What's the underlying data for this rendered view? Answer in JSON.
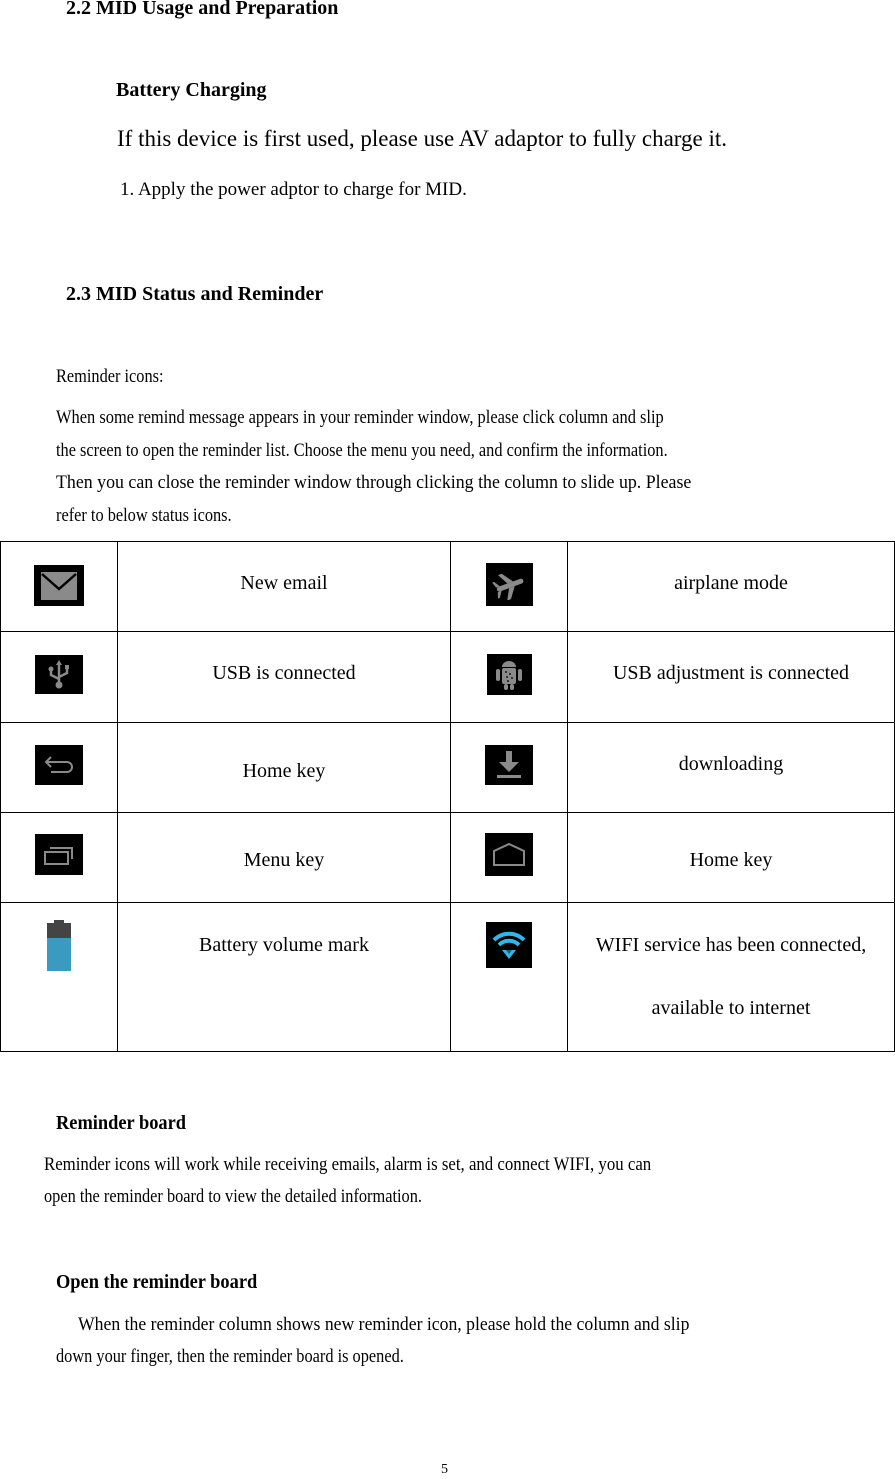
{
  "section_22": {
    "title": "2.2 MID Usage and Preparation",
    "battery_heading": "Battery Charging",
    "battery_note": "If this device is first used, please use AV adaptor to fully charge it.",
    "step_1": "1. Apply the power adptor to charge for MID."
  },
  "section_23": {
    "title": "2.3 MID Status and Reminder",
    "reminder_icons_label": "Reminder icons:",
    "paragraph_lines": [
      "When some remind message appears in your reminder window, please click column and slip",
      "the screen to open the reminder list. Choose the menu you need, and confirm the information.",
      "Then you can close the reminder window through clicking the column to slide up. Please",
      "refer to below status icons."
    ]
  },
  "icon_table": {
    "rows": [
      {
        "left": {
          "icon": "email-icon",
          "label": "New email"
        },
        "right": {
          "icon": "airplane-icon",
          "label": "airplane mode"
        }
      },
      {
        "left": {
          "icon": "usb-icon",
          "label": "USB is connected"
        },
        "right": {
          "icon": "android-debug-icon",
          "label": "USB adjustment is connected"
        }
      },
      {
        "left": {
          "icon": "back-arrow-icon",
          "label": "Home key"
        },
        "right": {
          "icon": "download-icon",
          "label": "downloading"
        }
      },
      {
        "left": {
          "icon": "recent-apps-icon",
          "label": "Menu key"
        },
        "right": {
          "icon": "home-icon",
          "label": "Home key"
        }
      },
      {
        "left": {
          "icon": "battery-icon",
          "label": "Battery volume mark"
        },
        "right": {
          "icon": "wifi-icon",
          "label": "WIFI service has been connected,",
          "label_line2": "available to internet"
        }
      }
    ],
    "colors": {
      "icon_gray": "#8a8a8a",
      "wifi_blue": "#33b5e5",
      "battery_blue": "#3a9ac0",
      "battery_dark": "#444444"
    }
  },
  "reminder_board": {
    "heading": "Reminder board",
    "lines": [
      "Reminder  icons will work  while receiving emails,  alarm is set, and connect  WIFI, you can",
      "open the reminder board to view the detailed information."
    ]
  },
  "open_reminder_board": {
    "heading": "Open the reminder board",
    "lines": [
      "When  the reminder column shows new reminder icon, please hold the  column and slip",
      "down your finger, then the reminder board is opened."
    ]
  },
  "page_number": "5"
}
